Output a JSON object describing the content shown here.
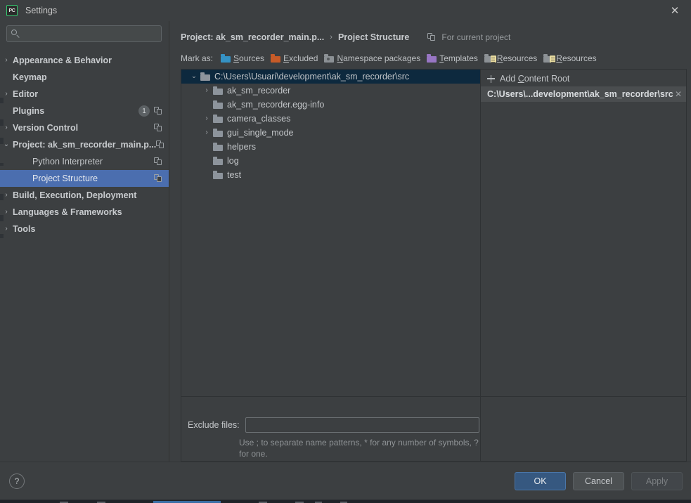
{
  "window": {
    "title": "Settings",
    "app_icon": "pycharm-icon",
    "app_icon_text": "PC",
    "close_icon": "✕",
    "accent_color": "#4b6eaf",
    "primary_button_color": "#365880"
  },
  "search": {
    "placeholder": "",
    "value": "",
    "icon": "search-icon"
  },
  "sidebar": {
    "items": [
      {
        "label": "Appearance & Behavior",
        "arrow": "›",
        "expandable": true,
        "bold": true,
        "child": false,
        "selected": false,
        "badge": null,
        "copy_icon": false
      },
      {
        "label": "Keymap",
        "arrow": "",
        "expandable": false,
        "bold": true,
        "child": false,
        "selected": false,
        "badge": null,
        "copy_icon": false
      },
      {
        "label": "Editor",
        "arrow": "›",
        "expandable": true,
        "bold": true,
        "child": false,
        "selected": false,
        "badge": null,
        "copy_icon": false
      },
      {
        "label": "Plugins",
        "arrow": "",
        "expandable": false,
        "bold": true,
        "child": false,
        "selected": false,
        "badge": "1",
        "copy_icon": true
      },
      {
        "label": "Version Control",
        "arrow": "›",
        "expandable": true,
        "bold": true,
        "child": false,
        "selected": false,
        "badge": null,
        "copy_icon": true
      },
      {
        "label": "Project: ak_sm_recorder_main.p...",
        "arrow": "⌄",
        "expandable": true,
        "bold": true,
        "child": false,
        "selected": false,
        "badge": null,
        "copy_icon": true
      },
      {
        "label": "Python Interpreter",
        "arrow": "",
        "expandable": false,
        "bold": false,
        "child": true,
        "selected": false,
        "badge": null,
        "copy_icon": true
      },
      {
        "label": "Project Structure",
        "arrow": "",
        "expandable": false,
        "bold": false,
        "child": true,
        "selected": true,
        "badge": null,
        "copy_icon": true
      },
      {
        "label": "Build, Execution, Deployment",
        "arrow": "›",
        "expandable": true,
        "bold": true,
        "child": false,
        "selected": false,
        "badge": null,
        "copy_icon": false
      },
      {
        "label": "Languages & Frameworks",
        "arrow": "›",
        "expandable": true,
        "bold": true,
        "child": false,
        "selected": false,
        "badge": null,
        "copy_icon": false
      },
      {
        "label": "Tools",
        "arrow": "›",
        "expandable": true,
        "bold": true,
        "child": false,
        "selected": false,
        "badge": null,
        "copy_icon": false
      }
    ]
  },
  "main": {
    "breadcrumb": {
      "parent": "Project: ak_sm_recorder_main.p...",
      "separator": "›",
      "current": "Project Structure"
    },
    "for_current_project": {
      "label": "For current project",
      "icon": "copy-icon"
    },
    "mark_as": {
      "label": "Mark as:",
      "options": [
        {
          "label": "Sources",
          "underline": "S",
          "rest": "ources",
          "icon": "folder-sources-icon",
          "color": "#3592c4",
          "style": "folder-blue"
        },
        {
          "label": "Excluded",
          "underline": "E",
          "rest": "xcluded",
          "icon": "folder-excluded-icon",
          "color": "#c75b28",
          "style": "folder-orange"
        },
        {
          "label": "Namespace packages",
          "underline": "N",
          "rest": "amespace packages",
          "icon": "folder-namespace-icon",
          "color": "#8c9195",
          "style": "folder-gray ns"
        },
        {
          "label": "Templates",
          "underline": "T",
          "rest": "emplates",
          "icon": "folder-templates-icon",
          "color": "#9876c4",
          "style": "folder-purple"
        },
        {
          "label": "Resources",
          "underline": "R",
          "rest": "esources",
          "icon": "folder-resources-icon",
          "color": "#8c9195",
          "style": "folder-gray res"
        },
        {
          "label": "Resources",
          "underline": "R",
          "rest": "esources",
          "icon": "folder-resources-alt-icon",
          "color": "#8c9195",
          "style": "folder-gray res"
        }
      ]
    },
    "tree": {
      "selected_row_color": "#0d293e",
      "rows": [
        {
          "label": "C:\\Users\\Usuari\\development\\ak_sm_recorder\\src",
          "arrow": "⌄",
          "expandable": true,
          "depth": 0,
          "selected": true
        },
        {
          "label": "ak_sm_recorder",
          "arrow": "›",
          "expandable": true,
          "depth": 1,
          "selected": false
        },
        {
          "label": "ak_sm_recorder.egg-info",
          "arrow": "",
          "expandable": false,
          "depth": 1,
          "selected": false
        },
        {
          "label": "camera_classes",
          "arrow": "›",
          "expandable": true,
          "depth": 1,
          "selected": false
        },
        {
          "label": "gui_single_mode",
          "arrow": "›",
          "expandable": true,
          "depth": 1,
          "selected": false
        },
        {
          "label": "helpers",
          "arrow": "",
          "expandable": false,
          "depth": 1,
          "selected": false
        },
        {
          "label": "log",
          "arrow": "",
          "expandable": false,
          "depth": 1,
          "selected": false
        },
        {
          "label": "test",
          "arrow": "",
          "expandable": false,
          "depth": 1,
          "selected": false
        }
      ]
    },
    "content_roots": {
      "add_label": "Add Content Root",
      "add_underline": "C",
      "add_icon": "plus-icon",
      "entries": [
        {
          "path": "C:\\Users\\...development\\ak_sm_recorder\\src",
          "remove_icon": "✕",
          "selected": true
        }
      ]
    },
    "exclude": {
      "label": "Exclude files:",
      "value": "",
      "placeholder": "",
      "hint": "Use ; to separate name patterns, * for any number of symbols, ? for one."
    }
  },
  "footer": {
    "help_label": "?",
    "buttons": [
      {
        "label": "OK",
        "kind": "primary"
      },
      {
        "label": "Cancel",
        "kind": "normal"
      },
      {
        "label": "Apply",
        "kind": "disabled"
      }
    ]
  }
}
